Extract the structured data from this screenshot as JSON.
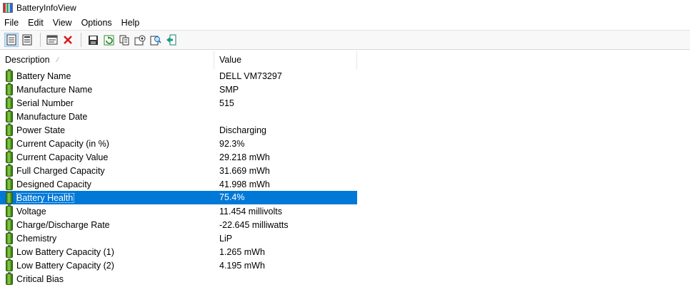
{
  "window": {
    "title": "BatteryInfoView"
  },
  "menu": [
    "File",
    "Edit",
    "View",
    "Options",
    "Help"
  ],
  "toolbar": {
    "buttons": [
      {
        "icon": "list-view-icon",
        "active": true
      },
      {
        "icon": "detail-view-icon",
        "active": false
      },
      {
        "icon": "properties-window-icon",
        "active": false
      },
      {
        "icon": "delete-x-icon",
        "active": false
      },
      {
        "icon": "save-disk-icon",
        "active": false
      },
      {
        "icon": "refresh-icon",
        "active": false
      },
      {
        "icon": "copy-icon",
        "active": false
      },
      {
        "icon": "html-report-icon",
        "active": false
      },
      {
        "icon": "find-icon",
        "active": false
      },
      {
        "icon": "exit-icon",
        "active": false
      }
    ]
  },
  "table": {
    "columns": [
      "Description",
      "Value"
    ],
    "rows": [
      {
        "description": "Battery Name",
        "value": "DELL VM73297"
      },
      {
        "description": "Manufacture Name",
        "value": "SMP"
      },
      {
        "description": "Serial Number",
        "value": "515"
      },
      {
        "description": "Manufacture Date",
        "value": ""
      },
      {
        "description": "Power State",
        "value": "Discharging"
      },
      {
        "description": "Current Capacity (in %)",
        "value": "92.3%"
      },
      {
        "description": "Current Capacity Value",
        "value": "29.218 mWh"
      },
      {
        "description": "Full Charged Capacity",
        "value": "31.669 mWh"
      },
      {
        "description": "Designed Capacity",
        "value": "41.998 mWh"
      },
      {
        "description": "Battery Health",
        "value": "75.4%",
        "selected": true
      },
      {
        "description": "Voltage",
        "value": "11.454 millivolts"
      },
      {
        "description": "Charge/Discharge Rate",
        "value": "-22.645 milliwatts"
      },
      {
        "description": "Chemistry",
        "value": "LiP"
      },
      {
        "description": "Low Battery Capacity (1)",
        "value": "1.265 mWh"
      },
      {
        "description": "Low Battery Capacity (2)",
        "value": "4.195 mWh"
      },
      {
        "description": "Critical Bias",
        "value": ""
      }
    ]
  },
  "colors": {
    "selection": "#0078d7",
    "battery_green": "#5aa223"
  }
}
